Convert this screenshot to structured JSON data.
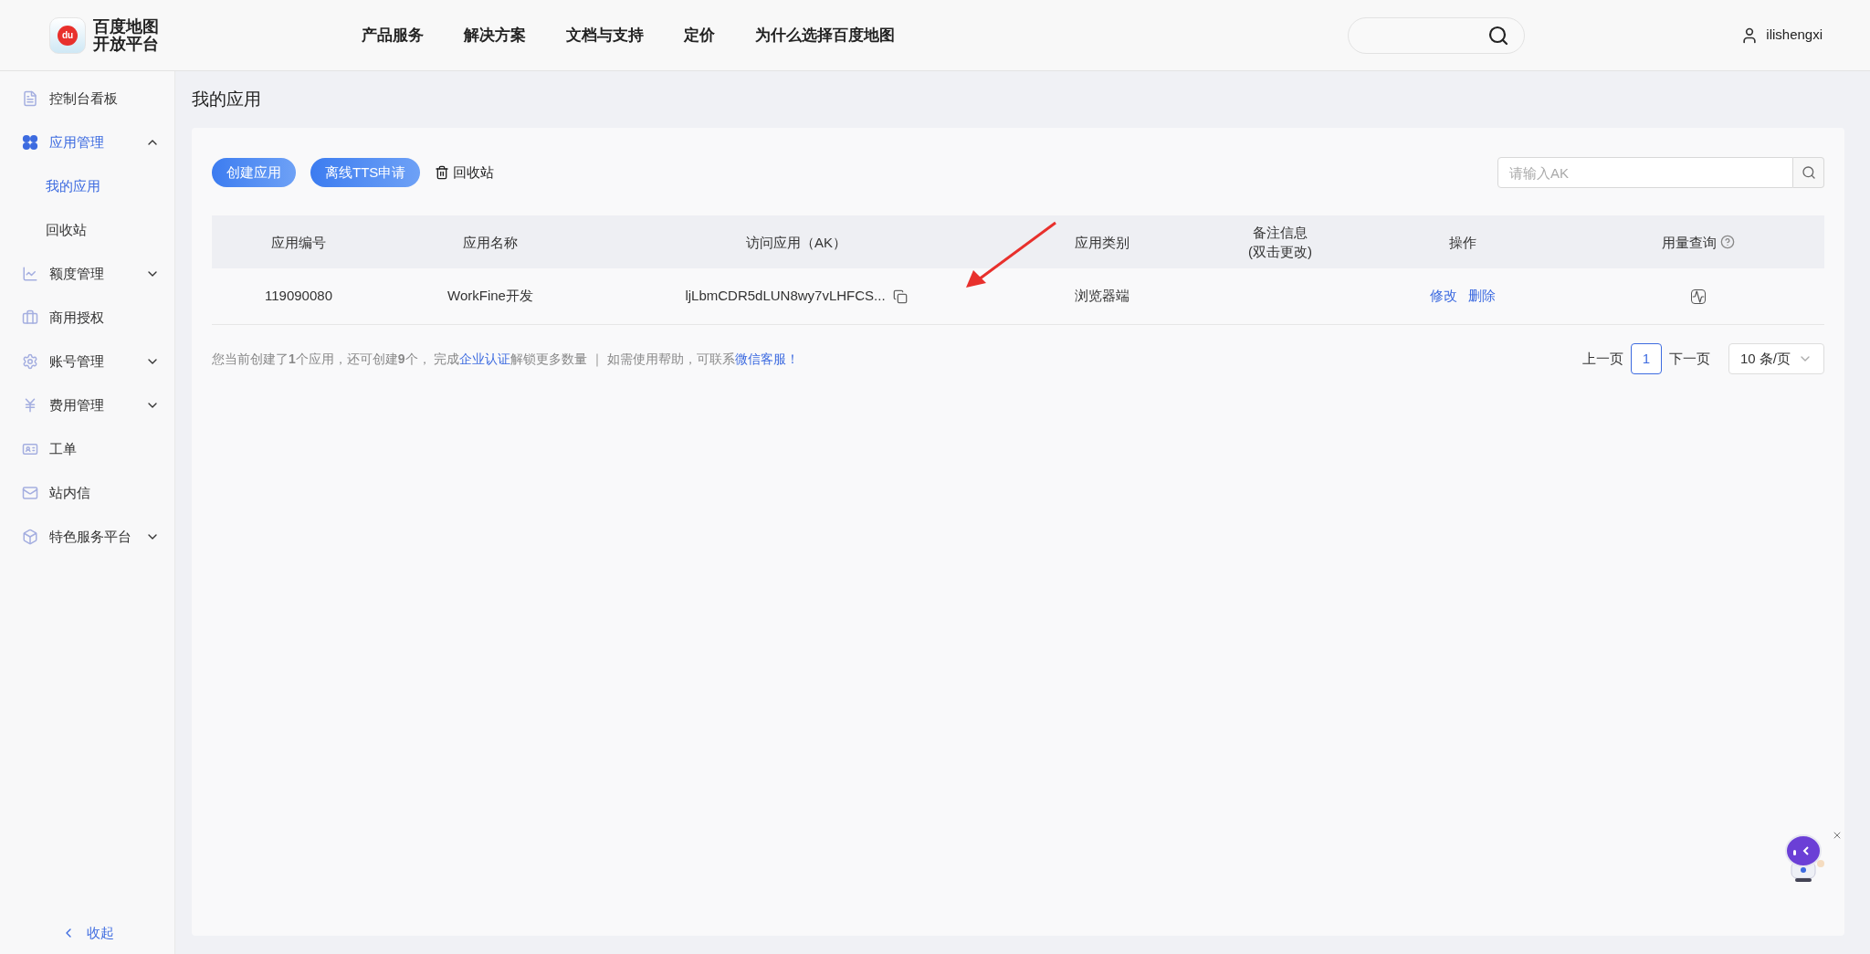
{
  "header": {
    "logo": {
      "mark": "du",
      "line1": "百度地图",
      "line2": "开放平台"
    },
    "nav": [
      "产品服务",
      "解决方案",
      "文档与支持",
      "定价",
      "为什么选择百度地图"
    ],
    "user": "ilishengxi"
  },
  "sidebar": {
    "items": [
      {
        "label": "控制台看板",
        "kind": "link",
        "selected": false
      },
      {
        "label": "应用管理",
        "kind": "group",
        "selected": true,
        "expanded": true,
        "children": [
          {
            "label": "我的应用",
            "selected": true
          },
          {
            "label": "回收站",
            "selected": false
          }
        ]
      },
      {
        "label": "额度管理",
        "kind": "group",
        "selected": false,
        "expanded": false
      },
      {
        "label": "商用授权",
        "kind": "link",
        "selected": false
      },
      {
        "label": "账号管理",
        "kind": "group",
        "selected": false,
        "expanded": false
      },
      {
        "label": "费用管理",
        "kind": "group",
        "selected": false,
        "expanded": false
      },
      {
        "label": "工单",
        "kind": "link",
        "selected": false
      },
      {
        "label": "站内信",
        "kind": "link",
        "selected": false
      },
      {
        "label": "特色服务平台",
        "kind": "group",
        "selected": false,
        "expanded": false
      }
    ],
    "collapse": "收起"
  },
  "page_title": "我的应用",
  "toolbar": {
    "buttons": [
      "创建应用",
      "离线TTS申请"
    ],
    "recycle": "回收站",
    "search": {
      "placeholder": "请输入AK"
    }
  },
  "table": {
    "columns": [
      {
        "label": "应用编号"
      },
      {
        "label": "应用名称"
      },
      {
        "label": "访问应用（AK）"
      },
      {
        "label": "应用类别"
      },
      {
        "label": "备注信息\n(双击更改)"
      },
      {
        "label": "操作"
      },
      {
        "label": "用量查询",
        "help": true
      }
    ],
    "rows": [
      {
        "id": "119090080",
        "name": "WorkFine开发",
        "ak": "ljLbmCDR5dLUN8wy7vLHFCS...",
        "type": "浏览器端",
        "actions": [
          "修改",
          "删除"
        ]
      }
    ]
  },
  "notice": [
    {
      "kind": "text",
      "text": "您当前创建了**1**个应用，还可创建**9**个， 完成"
    },
    {
      "kind": "link",
      "text": "企业认证"
    },
    {
      "kind": "text",
      "text": "解锁更多数量 ｜ 如需使用帮助，可联系"
    },
    {
      "kind": "link",
      "text": "微信客服！"
    }
  ],
  "pagination": {
    "prev": "上一页",
    "pages": [
      {
        "label": "1",
        "selected": true
      }
    ],
    "next": "下一页",
    "page_size": "10 条/页"
  },
  "annotation": {
    "kind": "arrow"
  },
  "assistant": {
    "kind": "mascot"
  }
}
